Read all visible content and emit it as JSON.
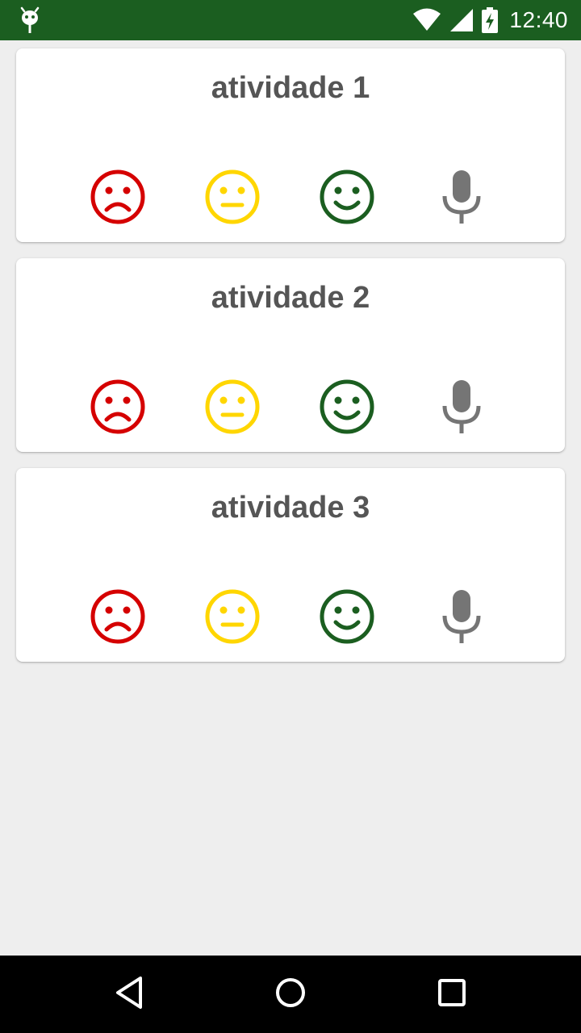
{
  "status_bar": {
    "time": "12:40",
    "icons": [
      "android-debug-icon",
      "wifi-icon",
      "signal-icon",
      "battery-charging-icon"
    ],
    "background": "#1b5e20"
  },
  "activities": [
    {
      "title": "atividade 1"
    },
    {
      "title": "atividade 2"
    },
    {
      "title": "atividade 3"
    }
  ],
  "rating_icons": [
    {
      "name": "sad-face-icon",
      "color": "#d50000"
    },
    {
      "name": "neutral-face-icon",
      "color": "#ffd600"
    },
    {
      "name": "happy-face-icon",
      "color": "#1b5e20"
    },
    {
      "name": "microphone-icon",
      "color": "#757575"
    }
  ],
  "nav_bar": {
    "icons": [
      "back-icon",
      "home-icon",
      "recents-icon"
    ]
  }
}
